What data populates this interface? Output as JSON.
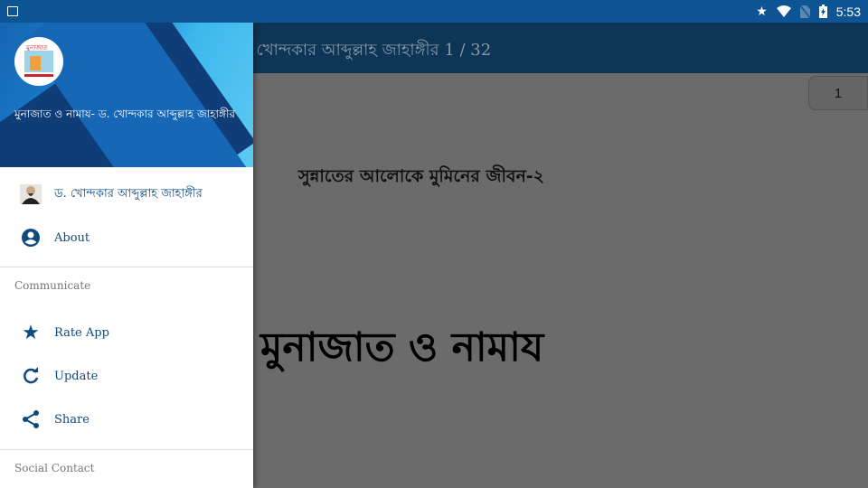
{
  "status_bar": {
    "time": "5:53",
    "icons": [
      "image-icon",
      "star-icon",
      "wifi-icon",
      "no-sim-icon",
      "battery-charging-icon"
    ]
  },
  "toolbar": {
    "title": "মুনাজাত ও নামায- ড. খোন্দকার আব্দুল্লাহ জাহাঙ্গীর",
    "page_indicator": "1 / 32"
  },
  "content": {
    "page_button": "1",
    "subtitle": "সুন্নাতের আলোকে মুমিনের জীবন-২",
    "heading": "মুনাজাত ও নামায"
  },
  "drawer": {
    "header_title": "মুনাজাত ও নামায- ড. খোন্দকার আব্দুল্লাহ জাহাঙ্গীর",
    "items": [
      {
        "label": "ড. খোন্দকার আব্দুল্লাহ জাহাঙ্গীর",
        "icon": "author-photo"
      },
      {
        "label": "About",
        "icon": "account-circle-icon"
      }
    ],
    "sections": [
      {
        "title": "Communicate",
        "items": [
          {
            "label": "Rate App",
            "icon": "star-icon"
          },
          {
            "label": "Update",
            "icon": "refresh-icon"
          },
          {
            "label": "Share",
            "icon": "share-icon"
          }
        ]
      },
      {
        "title": "Social Contact",
        "items": []
      }
    ]
  },
  "colors": {
    "accent": "#0d4a7e",
    "status_bar": "#0c5494",
    "toolbar": "#0c3556"
  }
}
